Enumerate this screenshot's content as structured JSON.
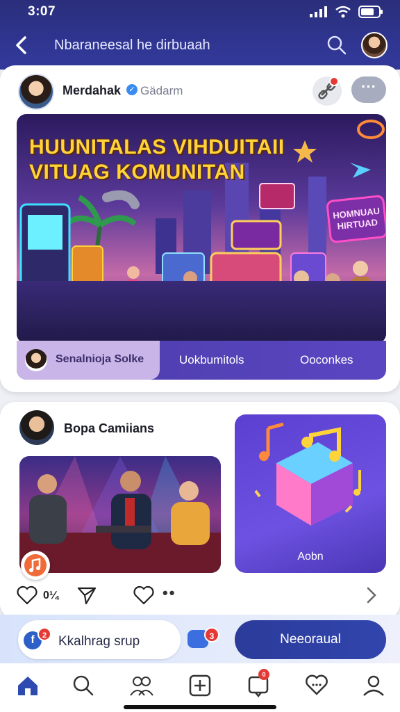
{
  "status": {
    "time": "3:07"
  },
  "header": {
    "title": "Nbaraneesal he dirbuaah",
    "icons": [
      "back-chevron-icon",
      "search-icon"
    ]
  },
  "post1": {
    "author": "Merdahak",
    "subtitle": "Gädarm",
    "banner_title_line1": "HUUNITALAS VIHDUITAII",
    "banner_title_line2": "VITUAG KOMUNITAN",
    "neon_sign": "HOMNUAU HIRTUAD",
    "tabs": {
      "active_label": "Senalnioja Solke",
      "tab2": "Uokbumitols",
      "tab3": "Ooconkes"
    }
  },
  "post2": {
    "author": "Bopa Camiians",
    "music_label": "Aobn",
    "likes": "0¼"
  },
  "composer": {
    "placeholder": "Kkalhrag srup",
    "fb_badge": "2",
    "chat_badge": "3",
    "button_label": "Neeoraual"
  },
  "nav": {
    "items": [
      "home-icon",
      "search-icon",
      "friends-icon",
      "add-icon",
      "notifications-icon",
      "messages-icon",
      "profile-icon"
    ],
    "badge": "0"
  },
  "colors": {
    "header_bg": "#2f3590",
    "accent": "#3145ad",
    "badge_red": "#e53935",
    "banner_yellow": "#ffd33a"
  }
}
